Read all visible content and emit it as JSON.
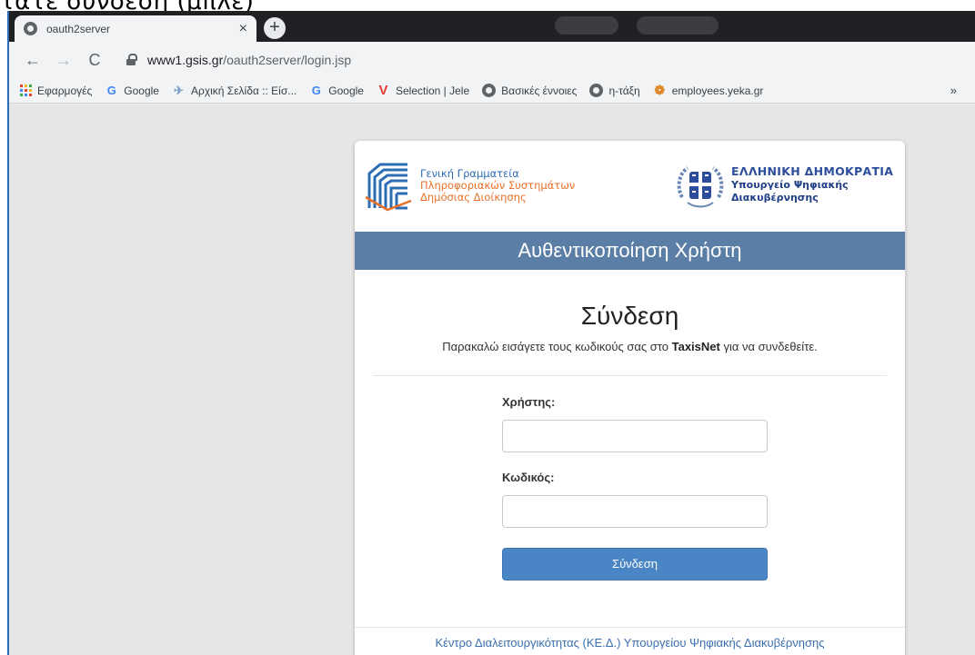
{
  "caption": "τατε σύνδεση (μπλε)",
  "browser": {
    "tab": {
      "title": "oauth2server",
      "close": "×"
    },
    "new_tab": "+",
    "nav": {
      "back": "←",
      "forward": "→",
      "reload": "C"
    },
    "address": {
      "host": "www1.gsis.gr",
      "path": "/oauth2server/login.jsp"
    },
    "bookmarks": [
      {
        "label": "Εφαρμογές",
        "icon": "apps-icon"
      },
      {
        "label": "Google",
        "icon": "google-icon"
      },
      {
        "label": "Αρχική Σελίδα :: Είσ...",
        "icon": "bird-icon"
      },
      {
        "label": "Google",
        "icon": "google-icon"
      },
      {
        "label": "Selection | Jele",
        "icon": "v-icon"
      },
      {
        "label": "Βασικές έννοιες",
        "icon": "globe-icon"
      },
      {
        "label": "η-τάξη",
        "icon": "globe-icon"
      },
      {
        "label": "employees.yeka.gr",
        "icon": "yeka-icon"
      }
    ],
    "bookmarks_more": "»"
  },
  "page": {
    "gsis": {
      "line1": "Γενική Γραμματεία",
      "line2": "Πληροφοριακών Συστημάτων",
      "line3": "Δημόσιας Διοίκησης"
    },
    "hellenic": {
      "title": "ΕΛΛΗΝΙΚΗ ΔΗΜΟΚΡΑΤΙΑ",
      "line1": "Υπουργείο Ψηφιακής",
      "line2": "Διακυβέρνησης"
    },
    "banner": "Αυθεντικοποίηση Χρήστη",
    "login_title": "Σύνδεση",
    "subtitle_before": "Παρακαλώ εισάγετε τους κωδικούς σας στο ",
    "subtitle_bold": "TaxisNet",
    "subtitle_after": " για να συνδεθείτε.",
    "username_label": "Χρήστης:",
    "username_value": "",
    "password_label": "Κωδικός:",
    "password_value": "",
    "submit_label": "Σύνδεση",
    "footer_link": "Κέντρο Διαλειτουργικότητας (ΚΕ.Δ.) Υπουργείου Ψηφιακής Διακυβέρνησης"
  },
  "colors": {
    "banner_bg": "#5b7ea6",
    "button_bg": "#4a86c6",
    "link": "#3a6fb0",
    "gsis_blue": "#2d6db5",
    "gsis_orange": "#e76f2a"
  }
}
